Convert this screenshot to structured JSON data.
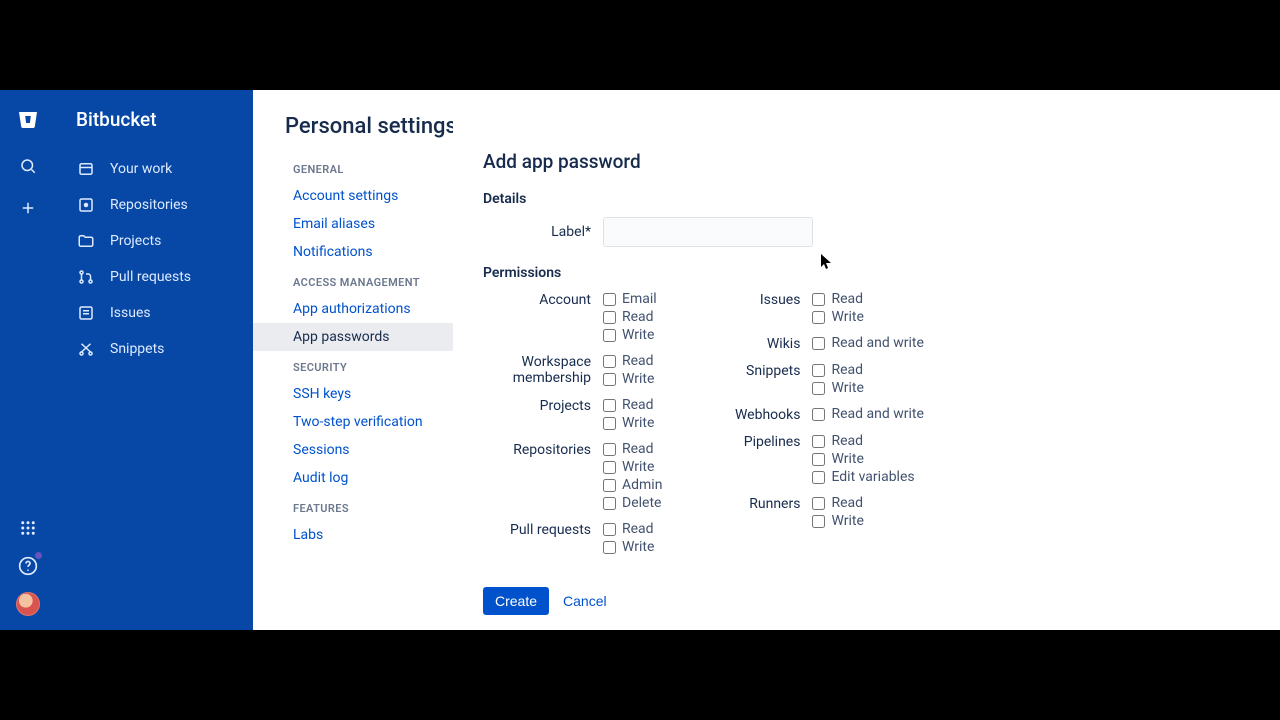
{
  "product_name": "Bitbucket",
  "rail": {
    "search_icon": "search-icon",
    "create_icon": "plus-icon"
  },
  "nav": {
    "items": [
      {
        "icon": "work-icon",
        "label": "Your work"
      },
      {
        "icon": "repo-icon",
        "label": "Repositories"
      },
      {
        "icon": "folder-icon",
        "label": "Projects"
      },
      {
        "icon": "pr-icon",
        "label": "Pull requests"
      },
      {
        "icon": "issues-icon",
        "label": "Issues"
      },
      {
        "icon": "snippets-icon",
        "label": "Snippets"
      }
    ]
  },
  "page": {
    "title": "Personal settings"
  },
  "settings_groups": [
    {
      "title": "GENERAL",
      "items": [
        {
          "label": "Account settings"
        },
        {
          "label": "Email aliases"
        },
        {
          "label": "Notifications"
        }
      ]
    },
    {
      "title": "ACCESS MANAGEMENT",
      "items": [
        {
          "label": "App authorizations"
        },
        {
          "label": "App passwords",
          "active": true
        }
      ]
    },
    {
      "title": "SECURITY",
      "items": [
        {
          "label": "SSH keys"
        },
        {
          "label": "Two-step verification"
        },
        {
          "label": "Sessions"
        },
        {
          "label": "Audit log"
        }
      ]
    },
    {
      "title": "FEATURES",
      "items": [
        {
          "label": "Labs"
        }
      ]
    }
  ],
  "form": {
    "heading": "Add app password",
    "details_heading": "Details",
    "label_field": "Label*",
    "permissions_heading": "Permissions",
    "left_groups": [
      {
        "name": "Account",
        "options": [
          "Email",
          "Read",
          "Write"
        ]
      },
      {
        "name": "Workspace membership",
        "options": [
          "Read",
          "Write"
        ]
      },
      {
        "name": "Projects",
        "options": [
          "Read",
          "Write"
        ]
      },
      {
        "name": "Repositories",
        "options": [
          "Read",
          "Write",
          "Admin",
          "Delete"
        ]
      },
      {
        "name": "Pull requests",
        "options": [
          "Read",
          "Write"
        ]
      }
    ],
    "right_groups": [
      {
        "name": "Issues",
        "options": [
          "Read",
          "Write"
        ]
      },
      {
        "name": "Wikis",
        "options": [
          "Read and write"
        ]
      },
      {
        "name": "Snippets",
        "options": [
          "Read",
          "Write"
        ]
      },
      {
        "name": "Webhooks",
        "options": [
          "Read and write"
        ]
      },
      {
        "name": "Pipelines",
        "options": [
          "Read",
          "Write",
          "Edit variables"
        ]
      },
      {
        "name": "Runners",
        "options": [
          "Read",
          "Write"
        ]
      }
    ],
    "create_label": "Create",
    "cancel_label": "Cancel"
  }
}
